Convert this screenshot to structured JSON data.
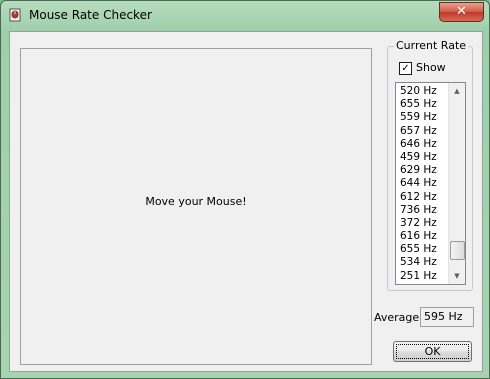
{
  "window": {
    "title": "Mouse Rate Checker",
    "close_symbol": "✕"
  },
  "canvas": {
    "prompt": "Move your Mouse!"
  },
  "current_rate": {
    "group_title": "Current Rate",
    "show_label": "Show",
    "show_checked": true,
    "checkmark": "✓",
    "rates": [
      "520 Hz",
      "655 Hz",
      "559 Hz",
      "657 Hz",
      "646 Hz",
      "459 Hz",
      "629 Hz",
      "644 Hz",
      "612 Hz",
      "736 Hz",
      "372 Hz",
      "616 Hz",
      "655 Hz",
      "534 Hz",
      "251 Hz"
    ],
    "scroll_up": "▲",
    "scroll_down": "▼"
  },
  "average": {
    "label": "Average",
    "value": "595 Hz"
  },
  "buttons": {
    "ok_label": "OK"
  },
  "icons": {
    "app": "mouse-app-icon",
    "close": "close-icon"
  }
}
